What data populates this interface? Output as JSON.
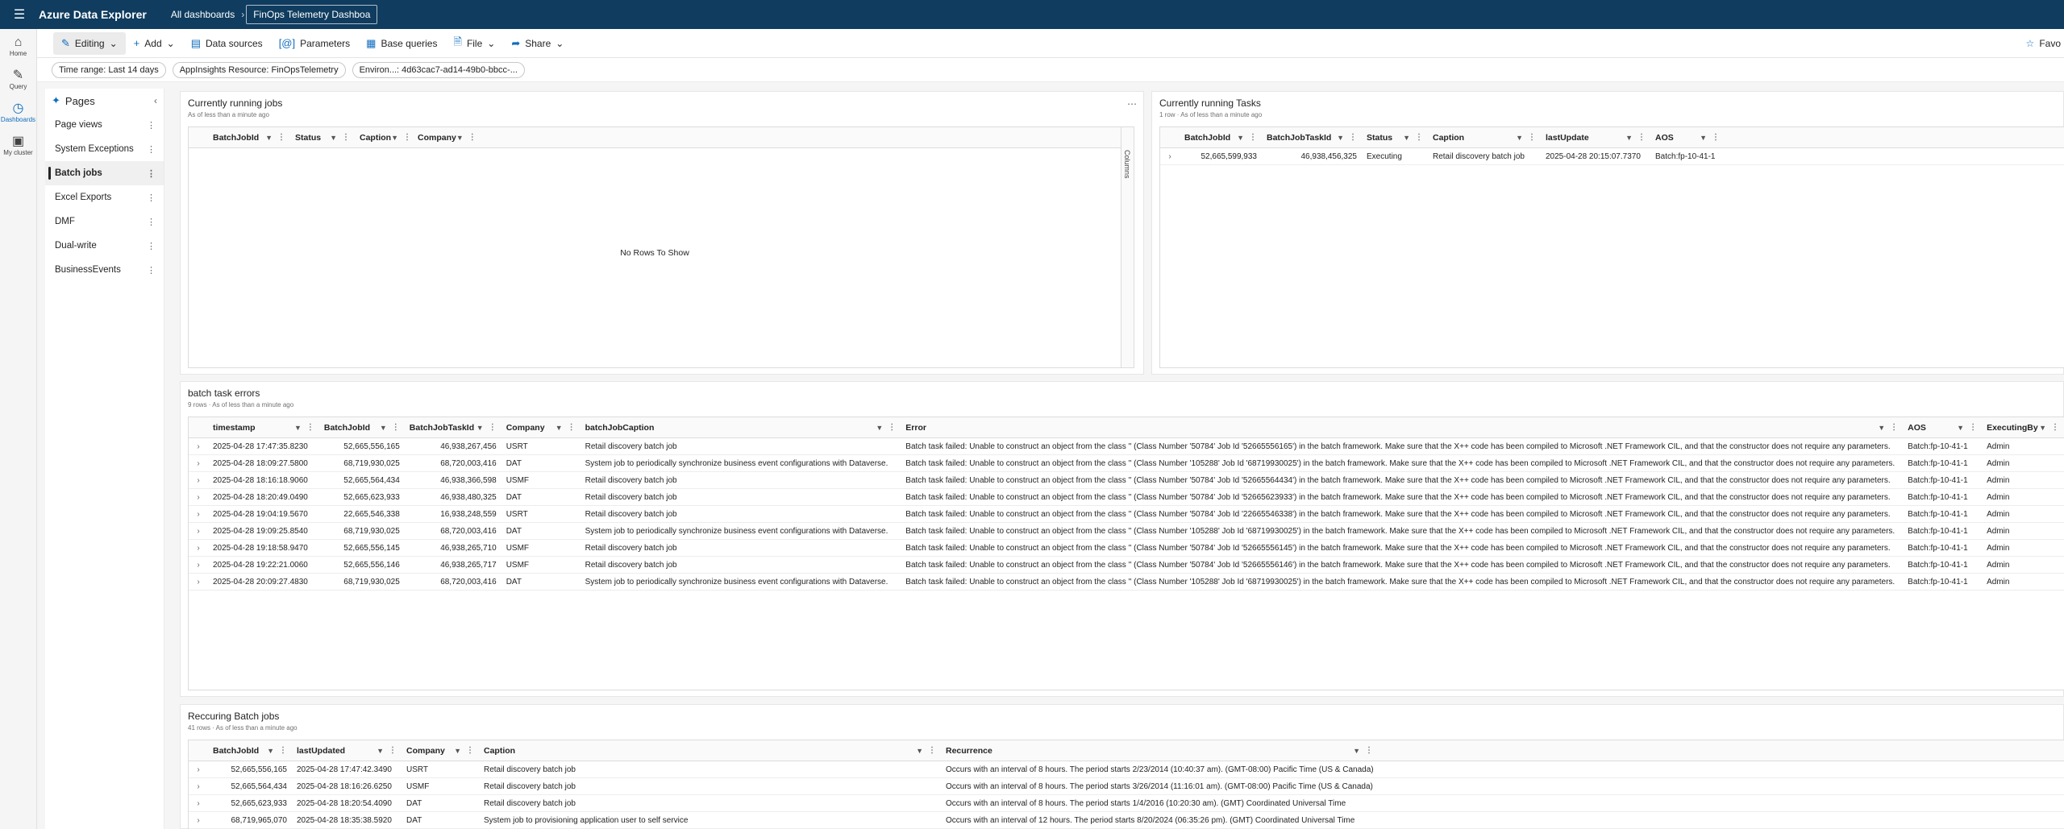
{
  "topbar": {
    "app_title": "Azure Data Explorer",
    "crumb_root": "All dashboards",
    "crumb_current": "FinOps Telemetry Dashboa"
  },
  "rail": [
    {
      "label": "Home",
      "icon": "home-icon"
    },
    {
      "label": "Query",
      "icon": "query-icon"
    },
    {
      "label": "Dashboards",
      "icon": "dashboard-icon",
      "active": true
    },
    {
      "label": "My cluster",
      "icon": "cluster-icon"
    }
  ],
  "toolbar": {
    "editing": "Editing",
    "add": "Add",
    "data_sources": "Data sources",
    "parameters": "Parameters",
    "base_queries": "Base queries",
    "file": "File",
    "share": "Share",
    "favorite": "Favo"
  },
  "params": {
    "time_range": "Time range: Last 14 days",
    "appinsights": "AppInsights Resource: FinOpsTelemetry",
    "environment": "Environ...: 4d63cac7-ad14-49b0-bbcc-..."
  },
  "pages": {
    "title": "Pages",
    "items": [
      "Page views",
      "System Exceptions",
      "Batch jobs",
      "Excel Exports",
      "DMF",
      "Dual-write",
      "BusinessEvents"
    ],
    "active": "Batch jobs"
  },
  "running_jobs": {
    "title": "Currently running jobs",
    "subtitle": "As of less than a minute ago",
    "columns": [
      "BatchJobId",
      "Status",
      "Caption",
      "Company"
    ],
    "empty": "No Rows To Show",
    "side_label": "Columns"
  },
  "running_tasks": {
    "title": "Currently running Tasks",
    "subtitle": "1 row · As of less than a minute ago",
    "columns": [
      "BatchJobId",
      "BatchJobTaskId",
      "Status",
      "Caption",
      "lastUpdate",
      "AOS"
    ],
    "rows": [
      [
        "52,665,599,933",
        "46,938,456,325",
        "Executing",
        "Retail discovery batch job",
        "2025-04-28 20:15:07.7370",
        "Batch:fp-10-41-1"
      ]
    ]
  },
  "task_errors": {
    "title": "batch task errors",
    "subtitle": "9 rows · As of less than a minute ago",
    "columns": [
      "timestamp",
      "BatchJobId",
      "BatchJobTaskId",
      "Company",
      "batchJobCaption",
      "Error",
      "AOS",
      "ExecutingBy"
    ],
    "rows": [
      [
        "2025-04-28 17:47:35.8230",
        "52,665,556,165",
        "46,938,267,456",
        "USRT",
        "Retail discovery batch job",
        "Batch task failed: Unable to construct an object from the class '' (Class Number '50784' Job Id '52665556165') in the batch framework. Make sure that the X++ code has been compiled to Microsoft .NET Framework CIL, and that the constructor does not require any parameters.",
        "Batch:fp-10-41-1",
        "Admin"
      ],
      [
        "2025-04-28 18:09:27.5800",
        "68,719,930,025",
        "68,720,003,416",
        "DAT",
        "System job to periodically synchronize business event configurations with Dataverse.",
        "Batch task failed: Unable to construct an object from the class '' (Class Number '105288' Job Id '68719930025') in the batch framework. Make sure that the X++ code has been compiled to Microsoft .NET Framework CIL, and that the constructor does not require any parameters.",
        "Batch:fp-10-41-1",
        "Admin"
      ],
      [
        "2025-04-28 18:16:18.9060",
        "52,665,564,434",
        "46,938,366,598",
        "USMF",
        "Retail discovery batch job",
        "Batch task failed: Unable to construct an object from the class '' (Class Number '50784' Job Id '52665564434') in the batch framework. Make sure that the X++ code has been compiled to Microsoft .NET Framework CIL, and that the constructor does not require any parameters.",
        "Batch:fp-10-41-1",
        "Admin"
      ],
      [
        "2025-04-28 18:20:49.0490",
        "52,665,623,933",
        "46,938,480,325",
        "DAT",
        "Retail discovery batch job",
        "Batch task failed: Unable to construct an object from the class '' (Class Number '50784' Job Id '52665623933') in the batch framework. Make sure that the X++ code has been compiled to Microsoft .NET Framework CIL, and that the constructor does not require any parameters.",
        "Batch:fp-10-41-1",
        "Admin"
      ],
      [
        "2025-04-28 19:04:19.5670",
        "22,665,546,338",
        "16,938,248,559",
        "USRT",
        "Retail discovery batch job",
        "Batch task failed: Unable to construct an object from the class '' (Class Number '50784' Job Id '22665546338') in the batch framework. Make sure that the X++ code has been compiled to Microsoft .NET Framework CIL, and that the constructor does not require any parameters.",
        "Batch:fp-10-41-1",
        "Admin"
      ],
      [
        "2025-04-28 19:09:25.8540",
        "68,719,930,025",
        "68,720,003,416",
        "DAT",
        "System job to periodically synchronize business event configurations with Dataverse.",
        "Batch task failed: Unable to construct an object from the class '' (Class Number '105288' Job Id '68719930025') in the batch framework. Make sure that the X++ code has been compiled to Microsoft .NET Framework CIL, and that the constructor does not require any parameters.",
        "Batch:fp-10-41-1",
        "Admin"
      ],
      [
        "2025-04-28 19:18:58.9470",
        "52,665,556,145",
        "46,938,265,710",
        "USMF",
        "Retail discovery batch job",
        "Batch task failed: Unable to construct an object from the class '' (Class Number '50784' Job Id '52665556145') in the batch framework. Make sure that the X++ code has been compiled to Microsoft .NET Framework CIL, and that the constructor does not require any parameters.",
        "Batch:fp-10-41-1",
        "Admin"
      ],
      [
        "2025-04-28 19:22:21.0060",
        "52,665,556,146",
        "46,938,265,717",
        "USMF",
        "Retail discovery batch job",
        "Batch task failed: Unable to construct an object from the class '' (Class Number '50784' Job Id '52665556146') in the batch framework. Make sure that the X++ code has been compiled to Microsoft .NET Framework CIL, and that the constructor does not require any parameters.",
        "Batch:fp-10-41-1",
        "Admin"
      ],
      [
        "2025-04-28 20:09:27.4830",
        "68,719,930,025",
        "68,720,003,416",
        "DAT",
        "System job to periodically synchronize business event configurations with Dataverse.",
        "Batch task failed: Unable to construct an object from the class '' (Class Number '105288' Job Id '68719930025') in the batch framework. Make sure that the X++ code has been compiled to Microsoft .NET Framework CIL, and that the constructor does not require any parameters.",
        "Batch:fp-10-41-1",
        "Admin"
      ]
    ]
  },
  "recurring": {
    "title": "Reccuring Batch jobs",
    "subtitle": "41 rows · As of less than a minute ago",
    "columns": [
      "BatchJobId",
      "lastUpdated",
      "Company",
      "Caption",
      "Recurrence"
    ],
    "rows": [
      [
        "52,665,556,165",
        "2025-04-28 17:47:42.3490",
        "USRT",
        "Retail discovery batch job",
        "Occurs with an interval of 8 hours. The period starts 2/23/2014 (10:40:37 am). (GMT-08:00) Pacific Time (US & Canada)"
      ],
      [
        "52,665,564,434",
        "2025-04-28 18:16:26.6250",
        "USMF",
        "Retail discovery batch job",
        "Occurs with an interval of 8 hours. The period starts 3/26/2014 (11:16:01 am). (GMT-08:00) Pacific Time (US & Canada)"
      ],
      [
        "52,665,623,933",
        "2025-04-28 18:20:54.4090",
        "DAT",
        "Retail discovery batch job",
        "Occurs with an interval of 8 hours. The period starts 1/4/2016 (10:20:30 am). (GMT) Coordinated Universal Time"
      ],
      [
        "68,719,965,070",
        "2025-04-28 18:35:38.5920",
        "DAT",
        "System job to provisioning application user to self service",
        "Occurs with an interval of 12 hours. The period starts 8/20/2024 (06:35:26 pm). (GMT) Coordinated Universal Time"
      ]
    ]
  }
}
